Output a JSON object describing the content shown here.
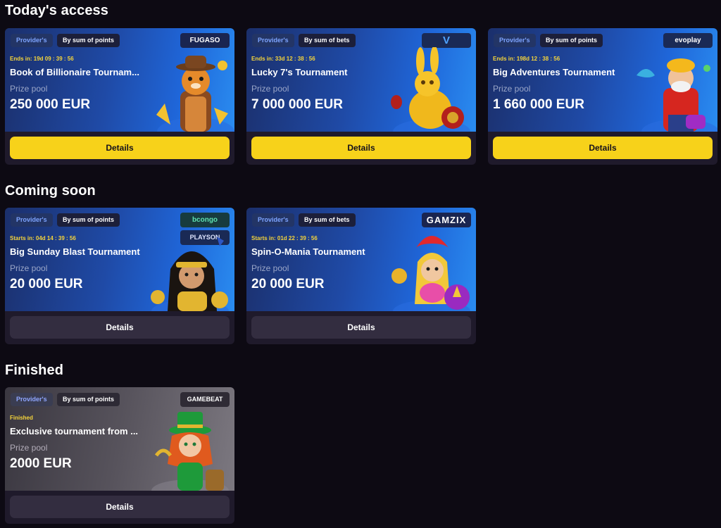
{
  "sections": {
    "today": "Today's access",
    "coming": "Coming soon",
    "finished": "Finished"
  },
  "chips": {
    "provider": "Provider's"
  },
  "cards": [
    {
      "sort": "By sum of points",
      "logo": "FUGASO",
      "timer": "Ends in: 19d 09 : 39 : 56",
      "name": "Book of Billionaire Tournam...",
      "pool_label": "Prize pool",
      "pool": "250 000 EUR",
      "button": "Details"
    },
    {
      "sort": "By sum of bets",
      "logo": "V",
      "timer": "Ends in: 33d 12 : 38 : 56",
      "name": "Lucky 7's Tournament",
      "pool_label": "Prize pool",
      "pool": "7 000 000 EUR",
      "button": "Details"
    },
    {
      "sort": "By sum of points",
      "logo": "evoplay",
      "timer": "Ends in: 198d 12 : 38 : 56",
      "name": "Big Adventures Tournament",
      "pool_label": "Prize pool",
      "pool": "1 660 000 EUR",
      "button": "Details"
    },
    {
      "sort": "By sum of points",
      "logo": "bcongo",
      "logo2": "PLAYSON",
      "timer": "Starts in: 04d 14 : 39 : 56",
      "name": "Big Sunday Blast Tournament",
      "pool_label": "Prize pool",
      "pool": "20 000 EUR",
      "button": "Details"
    },
    {
      "sort": "By sum of bets",
      "logo": "GAMZIX",
      "timer": "Starts in: 01d 22 : 39 : 56",
      "name": "Spin-O-Mania Tournament",
      "pool_label": "Prize pool",
      "pool": "20 000 EUR",
      "button": "Details"
    },
    {
      "sort": "By sum of points",
      "logo": "GAMEBEAT",
      "timer": "Finished",
      "name": "Exclusive tournament from ...",
      "pool_label": "Prize pool",
      "pool": "2000 EUR",
      "button": "Details"
    }
  ],
  "colors": {
    "background": "#0d0a13",
    "card": "#1f1a2b",
    "accent_yellow": "#f7d21a",
    "timer_yellow": "#f5d43b",
    "banner_blue": "#1f4aa6"
  },
  "icons": [
    "tiger-character-art",
    "golden-rabbit-art",
    "miner-character-art",
    "egyptian-queen-art",
    "carnival-dancer-art",
    "leprechaun-girl-art"
  ]
}
